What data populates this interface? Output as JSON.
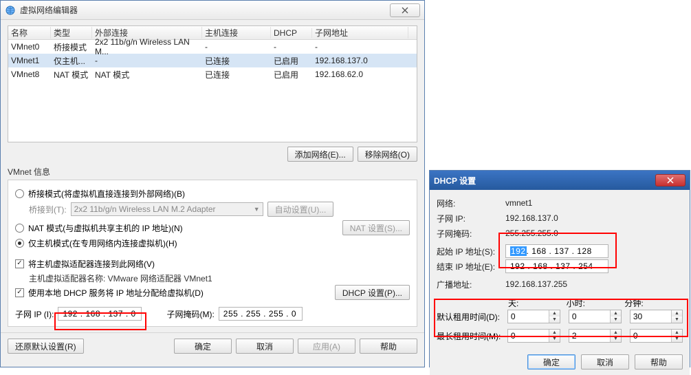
{
  "win1": {
    "title": "虚拟网络编辑器",
    "table": {
      "headers": {
        "name": "名称",
        "type": "类型",
        "ext": "外部连接",
        "host": "主机连接",
        "dhcp": "DHCP",
        "sub": "子网地址"
      },
      "rows": [
        {
          "name": "VMnet0",
          "type": "桥接模式",
          "ext": "2x2 11b/g/n Wireless LAN M...",
          "host": "-",
          "dhcp": "-",
          "sub": "-"
        },
        {
          "name": "VMnet1",
          "type": "仅主机...",
          "ext": "-",
          "host": "已连接",
          "dhcp": "已启用",
          "sub": "192.168.137.0"
        },
        {
          "name": "VMnet8",
          "type": "NAT 模式",
          "ext": "NAT 模式",
          "host": "已连接",
          "dhcp": "已启用",
          "sub": "192.168.62.0"
        }
      ]
    },
    "addNet": "添加网络(E)...",
    "removeNet": "移除网络(O)",
    "groupTitle": "VMnet 信息",
    "radioBridge": "桥接模式(将虚拟机直接连接到外部网络)(B)",
    "bridgeToLabel": "桥接到(T):",
    "bridgeToValue": "2x2 11b/g/n Wireless LAN M.2 Adapter",
    "autoSettings": "自动设置(U)...",
    "radioNat": "NAT 模式(与虚拟机共享主机的 IP 地址)(N)",
    "natSettings": "NAT 设置(S)...",
    "radioHost": "仅主机模式(在专用网络内连接虚拟机)(H)",
    "checkHostConn": "将主机虚拟适配器连接到此网络(V)",
    "hostAdapterLine": "主机虚拟适配器名称: VMware 网络适配器 VMnet1",
    "checkDhcp": "使用本地 DHCP 服务将 IP 地址分配给虚拟机(D)",
    "dhcpSettings": "DHCP 设置(P)...",
    "subnetIpLabel": "子网 IP (I):",
    "subnetIp": "192 . 168 . 137 .  0",
    "subnetMaskLabel": "子网掩码(M):",
    "subnetMask": "255 . 255 . 255 .  0",
    "restore": "还原默认设置(R)",
    "ok": "确定",
    "cancel": "取消",
    "apply": "应用(A)",
    "help": "帮助"
  },
  "win2": {
    "title": "DHCP 设置",
    "net": {
      "k": "网络:",
      "v": "vmnet1"
    },
    "subip": {
      "k": "子网 IP:",
      "v": "192.168.137.0"
    },
    "mask": {
      "k": "子网掩码:",
      "v": "255.255.255.0"
    },
    "startip": {
      "k": "起始 IP 地址(S):",
      "seg1": "192",
      "rest": " . 168  . 137  . 128"
    },
    "endip": {
      "k": "结束 IP 地址(E):",
      "v": "192  . 168  . 137  . 254"
    },
    "bcast": {
      "k": "广播地址:",
      "v": "192.168.137.255"
    },
    "heads": {
      "days": "天:",
      "hours": "小时:",
      "mins": "分钟:"
    },
    "defLease": {
      "k": "默认租用时间(D):",
      "d": "0",
      "h": "0",
      "m": "30"
    },
    "maxLease": {
      "k": "最长租用时间(M):",
      "d": "0",
      "h": "2",
      "m": "0"
    },
    "ok": "确定",
    "cancel": "取消",
    "help": "帮助"
  }
}
